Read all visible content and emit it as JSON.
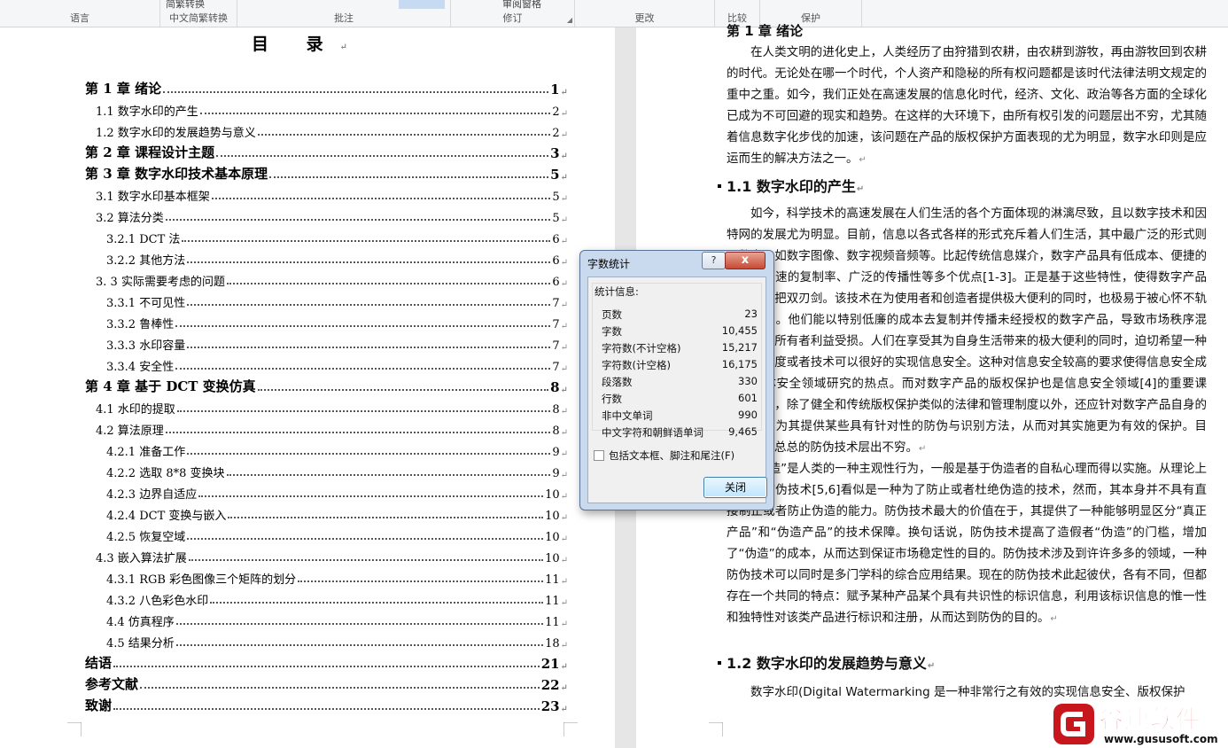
{
  "ribbon": {
    "groups": [
      {
        "label": "语言"
      },
      {
        "label": "中文简繁转换",
        "item": "简繁转换"
      },
      {
        "label": "批注"
      },
      {
        "label": "修订",
        "item": "审阅窗格"
      },
      {
        "label": "更改"
      },
      {
        "label": "比较"
      },
      {
        "label": "保护"
      }
    ]
  },
  "toc": {
    "title": "目  录",
    "entries": [
      {
        "text": "第 1 章  绪论",
        "page": "1",
        "level": 1
      },
      {
        "text": "1.1 数字水印的产生",
        "page": "2",
        "level": 2
      },
      {
        "text": "1.2 数字水印的发展趋势与意义",
        "page": "2",
        "level": 2
      },
      {
        "text": "第 2 章  课程设计主题",
        "page": "3",
        "level": 1
      },
      {
        "text": "第 3 章  数字水印技术基本原理",
        "page": "5",
        "level": 1
      },
      {
        "text": "3.1 数字水印基本框架",
        "page": "5",
        "level": 2
      },
      {
        "text": "3.2 算法分类",
        "page": "5",
        "level": 2
      },
      {
        "text": "3.2.1 DCT 法",
        "page": "6",
        "level": 3
      },
      {
        "text": "3.2.2  其他方法",
        "page": "6",
        "level": 3
      },
      {
        "text": "3. 3 实际需要考虑的问题",
        "page": "6",
        "level": 2
      },
      {
        "text": "3.3.1  不可见性",
        "page": "7",
        "level": 3
      },
      {
        "text": "3.3.2  鲁棒性",
        "page": "7",
        "level": 3
      },
      {
        "text": "3.3.3  水印容量",
        "page": "7",
        "level": 3
      },
      {
        "text": "3.3.4  安全性",
        "page": "7",
        "level": 3
      },
      {
        "text": "第 4 章  基于 DCT 变换仿真",
        "page": "8",
        "level": 1
      },
      {
        "text": "4.1 水印的提取",
        "page": "8",
        "level": 2
      },
      {
        "text": "4.2 算法原理",
        "page": "8",
        "level": 2
      },
      {
        "text": "4.2.1  准备工作",
        "page": "9",
        "level": 3
      },
      {
        "text": "4.2.2  选取 8*8 变换块",
        "page": "9",
        "level": 3
      },
      {
        "text": "4.2.3  边界自适应",
        "page": "10",
        "level": 3
      },
      {
        "text": "4.2.4  DCT 变换与嵌入",
        "page": "10",
        "level": 3
      },
      {
        "text": "4.2.5  恢复空域",
        "page": "10",
        "level": 3
      },
      {
        "text": "4.3 嵌入算法扩展",
        "page": "10",
        "level": 2
      },
      {
        "text": "4.3.1  RGB 彩色图像三个矩阵的划分",
        "page": "11",
        "level": 3
      },
      {
        "text": "4.3.2 八色彩色水印",
        "page": "11",
        "level": 3
      },
      {
        "text": "4.4 仿真程序",
        "page": "11",
        "level": 3
      },
      {
        "text": "4.5 结果分析",
        "page": "18",
        "level": 3
      },
      {
        "text": "结语",
        "page": "21",
        "level": 1
      },
      {
        "text": "参考文献",
        "page": "22",
        "level": 1
      },
      {
        "text": "致谢",
        "page": "23",
        "level": 1
      }
    ]
  },
  "right_page": {
    "top_heading": "第 1 章  绪论",
    "intro": "在人类文明的进化史上，人类经历了由狩猎到农耕，由农耕到游牧，再由游牧回到农耕的时代。无论处在哪一个时代，个人资产和隐秘的所有权问题都是该时代法律法明文规定的重中之重。如今，我们正处在高速发展的信息化时代，经济、文化、政治等各方面的全球化已成为不可回避的现实和趋势。在这样的大环境下，由所有权引发的问题层出不穷，尤其随着信息数字化步伐的加速，该问题在产品的版权保护方面表现的尤为明显，数字水印则是应运而生的解决方法之一。",
    "heading_1_1": "1.1  数字水印的产生",
    "para_1": "如今，科学技术的高速发展在人们生活的各个方面体现的淋漓尽致，且以数字技术和因特网的发展尤为明显。目前，信息以各式各样的形式充斥着人们生活，其中最广泛的形式则是数字，如数字图像、数字视频音频等。比起传统信息媒介，数字产品具有低成本、便捷的操作、高速的复制率、广泛的传播性等多个优点[1-3]。正是基于这些特性，使得数字产品变成了一把双刃剑。该技术在为使用者和创造者提供极大便利的同时，也极易于被心怀不轨者所利用。他们能以特别低廉的成本去复制并传播未经授权的数字产品，导致市场秩序混乱，版权所有者利益受损。人们在享受其为自身生活带来的极大便利的同时，迫切希望一种完善的制度或者技术可以很好的实现信息安全。这种对信息安全较高的要求使得信息安全成为多媒体安全领域研究的热点。而对数字产品的版权保护也是信息安全领域[4]的重要课题。因此，除了健全和传统版权保护类似的法律和管理制度以外，还应针对数字产品自身的独特性，为其提供某些具有针对性的防伪与识别方法，从而对其实施更为有效的保护。目前，林林总总的防伪技术层出不穷。",
    "para_2": "“伪造”是人类的一种主观性行为，一般是基于伪造者的自私心理而得以实施。从理论上来看，防伪技术[5,6]看似是一种为了防止或者杜绝伪造的技术，然而，其本身并不具有直接制止或者防止伪造的能力。防伪技术最大的价值在于，其提供了一种能够明显区分“真正产品”和“伪造产品”的技术保障。换句话说，防伪技术提高了造假者“伪造”的门槛，增加了“伪造”的成本，从而达到保证市场稳定性的目的。防伪技术涉及到许许多多的领域，一种防伪技术可以同时是多门学科的综合应用结果。现在的防伪技术此起彼伏，各有不同，但都存在一个共同的特点：赋予某种产品某个具有共识性的标识信息，利用该标识信息的惟一性和独特性对该类产品进行标识和注册，从而达到防伪的目的。",
    "heading_1_2": "1.2  数字水印的发展趋势与意义",
    "para_3": "数字水印(Digital Watermarking 是一种非常行之有效的实现信息安全、版权保护"
  },
  "dialog": {
    "title": "字数统计",
    "help": "?",
    "close_x": "x",
    "stats_header": "统计信息:",
    "stats": [
      {
        "label": "页数",
        "value": "23"
      },
      {
        "label": "字数",
        "value": "10,455"
      },
      {
        "label": "字符数(不计空格)",
        "value": "15,217"
      },
      {
        "label": "字符数(计空格)",
        "value": "16,175"
      },
      {
        "label": "段落数",
        "value": "330"
      },
      {
        "label": "行数",
        "value": "601"
      },
      {
        "label": "非中文单词",
        "value": "990"
      },
      {
        "label": "中文字符和朝鲜语单词",
        "value": "9,465"
      }
    ],
    "checkbox_label": "包括文本框、脚注和尾注(F)",
    "checkbox_checked": false,
    "close_button": "关闭"
  },
  "watermark": {
    "name": "谷速软件",
    "url": "www.gususoft.com",
    "color": "#c8161d"
  }
}
